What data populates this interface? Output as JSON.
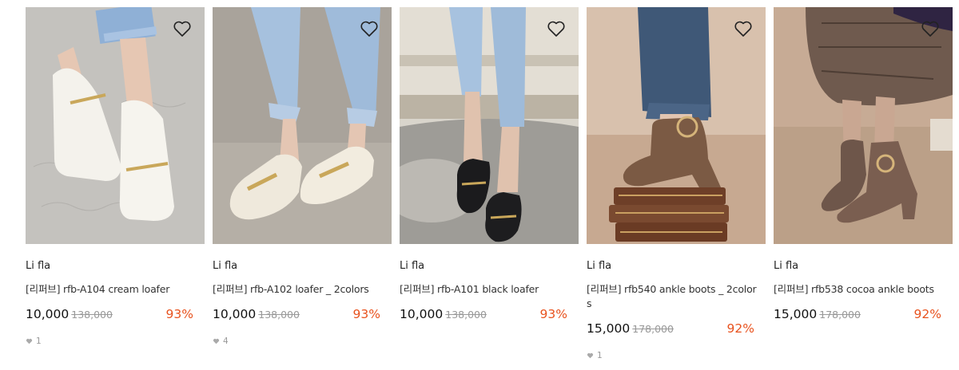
{
  "products": [
    {
      "brand": "Li fla",
      "name": "[리퍼브] rfb-A104 cream loafer",
      "price": "10,000",
      "original_price": "138,000",
      "discount": "93%",
      "likes": "1"
    },
    {
      "brand": "Li fla",
      "name": "[리퍼브] rfb-A102 loafer _ 2colors",
      "price": "10,000",
      "original_price": "138,000",
      "discount": "93%",
      "likes": "4"
    },
    {
      "brand": "Li fla",
      "name": "[리퍼브] rfb-A101 black loafer",
      "price": "10,000",
      "original_price": "138,000",
      "discount": "93%",
      "likes": ""
    },
    {
      "brand": "Li fla",
      "name": "[리퍼브] rfb540 ankle boots _ 2colors",
      "price": "15,000",
      "original_price": "178,000",
      "discount": "92%",
      "likes": "1"
    },
    {
      "brand": "Li fla",
      "name": "[리퍼브] rfb538 cocoa ankle boots",
      "price": "15,000",
      "original_price": "178,000",
      "discount": "92%",
      "likes": ""
    }
  ],
  "colors": {
    "discount": "#e8531f",
    "strike": "#999999",
    "accent": "#222222"
  },
  "icons": {
    "wishlist": "heart-outline-icon",
    "like": "heart-filled-icon"
  }
}
